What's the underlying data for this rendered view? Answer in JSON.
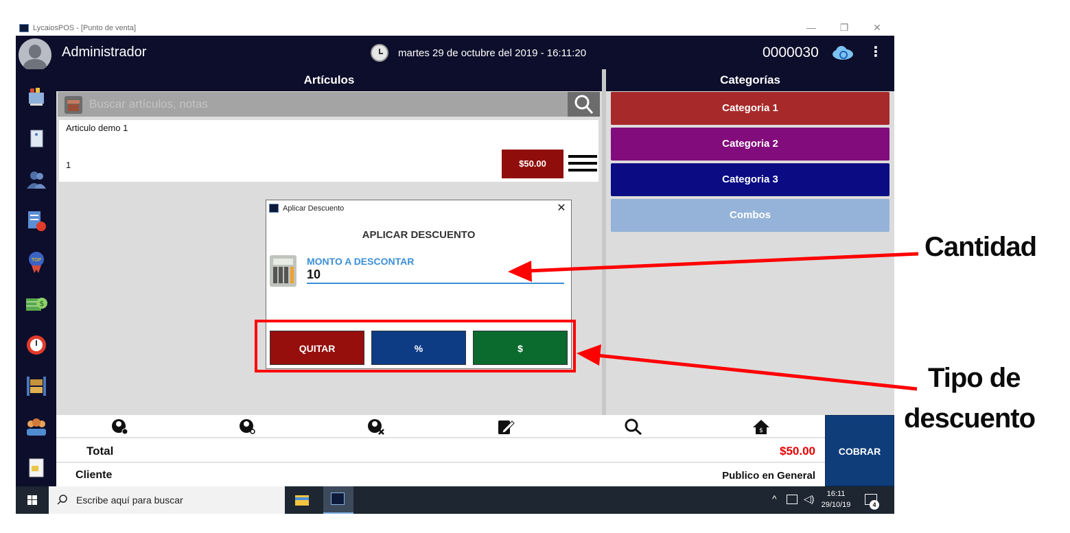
{
  "window": {
    "title": "LycaiosPOS - [Punto de venta]",
    "minimize": "—",
    "restore": "❐",
    "close": "✕"
  },
  "header": {
    "user": "Administrador",
    "datetime": "martes 29 de octubre del 2019 - 16:11:20",
    "ticket_number": "0000030"
  },
  "sidebar": {
    "items": [
      {
        "icon": "cart-icon",
        "color": "#8fb0d8"
      },
      {
        "icon": "notebook-icon",
        "color": "#dfe8f2"
      },
      {
        "icon": "customers-icon",
        "color": "#4f6fa8"
      },
      {
        "icon": "report-clock-icon",
        "color": "#5b8fd6"
      },
      {
        "icon": "top-badge-icon",
        "color": "#3a63c6"
      },
      {
        "icon": "money-icon",
        "color": "#58a84d"
      },
      {
        "icon": "stopwatch-icon",
        "color": "#e23b2a"
      },
      {
        "icon": "warehouse-icon",
        "color": "#c8923c"
      },
      {
        "icon": "users-group-icon",
        "color": "#e7a25a"
      },
      {
        "icon": "exit-icon",
        "color": "#e9c64b"
      }
    ]
  },
  "articles": {
    "header": "Artículos",
    "search_placeholder": "Buscar artículos, notas",
    "items": [
      {
        "name": "Articulo demo 1",
        "qty": "1",
        "price": "$50.00"
      }
    ]
  },
  "categories": {
    "header": "Categorías",
    "items": [
      {
        "label": "Categoria 1",
        "color": "#a8292a"
      },
      {
        "label": "Categoria 2",
        "color": "#820c7c"
      },
      {
        "label": "Categoria 3",
        "color": "#0b0c84"
      },
      {
        "label": "Combos",
        "color": "#95b3d8"
      }
    ]
  },
  "dialog": {
    "title": "Aplicar Descuento",
    "close": "✕",
    "heading": "APLICAR DESCUENTO",
    "amount_label": "MONTO A DESCONTAR",
    "amount_value": "10",
    "buttons": {
      "remove": "QUITAR",
      "percent": "%",
      "fixed": "$"
    },
    "button_colors": {
      "remove": "#960f0c",
      "percent": "#0d3c85",
      "fixed": "#0b6a2d"
    }
  },
  "annotations": {
    "quantity": "Cantidad",
    "type_line1": "Tipo de",
    "type_line2": "descuento",
    "color": "#ff0000"
  },
  "toolbar": {
    "icons": [
      "add-customer-icon",
      "search-customer-icon",
      "remove-customer-icon",
      "edit-note-icon",
      "search-icon",
      "home-icon"
    ]
  },
  "totals": {
    "total_label": "Total",
    "total_value": "$50.00",
    "client_label": "Cliente",
    "client_value": "Publico en General",
    "pay_button": "COBRAR"
  },
  "taskbar": {
    "search_text": "Escribe aquí para buscar",
    "time": "16:11",
    "date": "29/10/19",
    "notifications": "4"
  }
}
